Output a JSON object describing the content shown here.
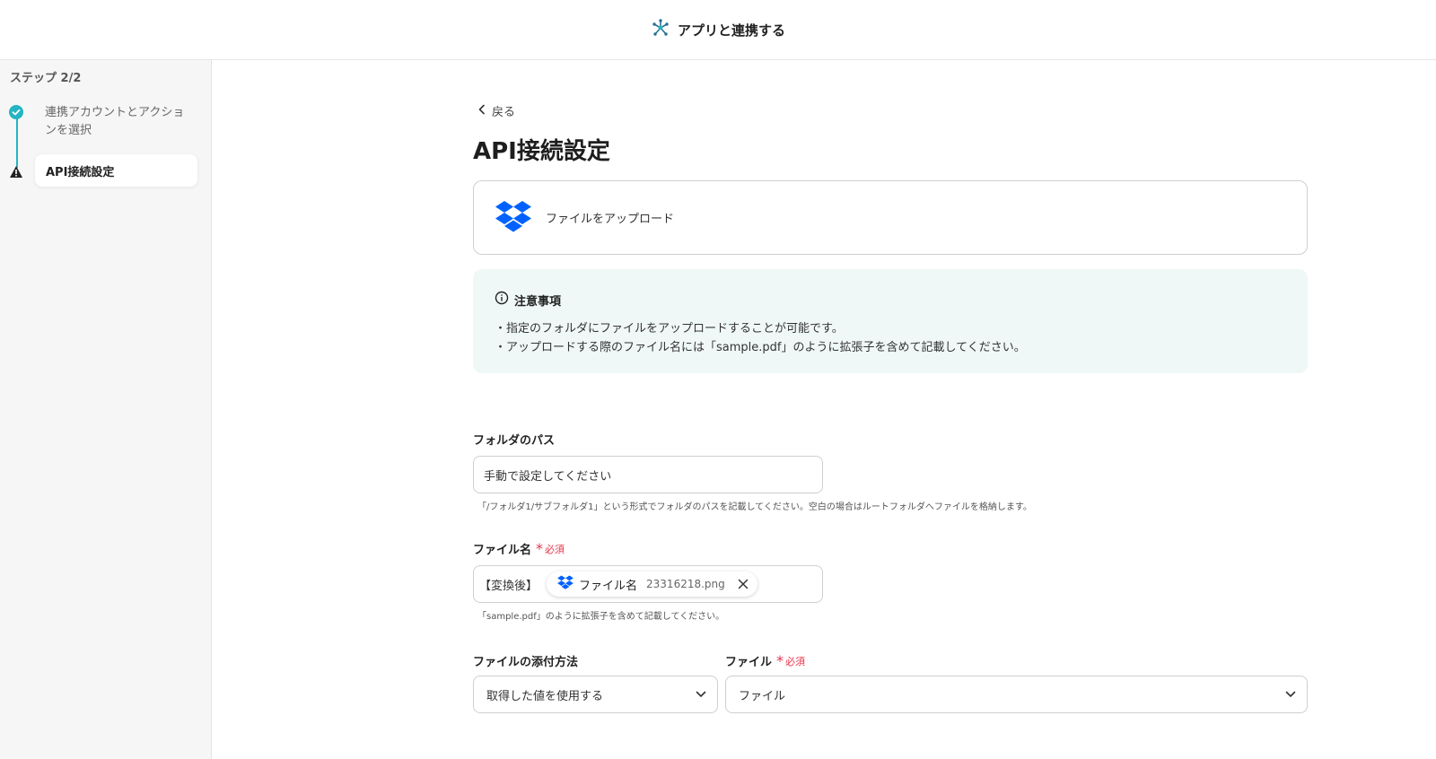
{
  "header": {
    "title": "アプリと連携する",
    "icon": "network-hub-icon"
  },
  "sidebar": {
    "step_label": "ステップ 2/2",
    "steps": [
      {
        "label": "連携アカウントとアクションを選択",
        "status": "done"
      },
      {
        "label": "API接続設定",
        "status": "warning"
      }
    ]
  },
  "main": {
    "back_label": "戻る",
    "title": "API接続設定",
    "app_card": {
      "action": "ファイルをアップロード",
      "icon": "dropbox-icon"
    },
    "notice": {
      "title": "注意事項",
      "lines": [
        "・指定のフォルダにファイルをアップロードすることが可能です。",
        "・アップロードする際のファイル名には「sample.pdf」のように拡張子を含めて記載してください。"
      ]
    },
    "folder_path": {
      "label": "フォルダのパス",
      "value": "手動で設定してください",
      "hint": "「/フォルダ1/サブフォルダ1」という形式でフォルダのパスを記載してください。空白の場合はルートフォルダへファイルを格納します。"
    },
    "file_name": {
      "label": "ファイル名",
      "required": "必須",
      "prefix": "【変換後】",
      "chip_name": "ファイル名",
      "chip_value": "23316218.png",
      "hint": "「sample.pdf」のように拡張子を含めて記載してください。"
    },
    "attach_method": {
      "label": "ファイルの添付方法",
      "value": "取得した値を使用する"
    },
    "file": {
      "label": "ファイル",
      "required": "必須",
      "value": "ファイル"
    }
  },
  "colors": {
    "accent": "#23b5c1",
    "required": "#e8334a",
    "notice_bg": "#eff8f7",
    "dropbox": "#0061fe"
  }
}
